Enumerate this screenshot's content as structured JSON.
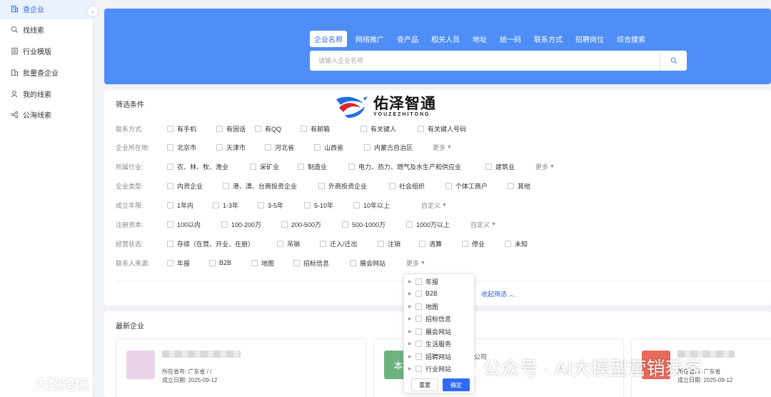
{
  "sidebar": {
    "items": [
      {
        "label": "查企业",
        "icon": "building-icon",
        "active": true
      },
      {
        "label": "找线索",
        "icon": "search-icon"
      },
      {
        "label": "行业模版",
        "icon": "document-icon"
      },
      {
        "label": "批量查企业",
        "icon": "buildings-icon"
      },
      {
        "label": "我的线索",
        "icon": "user-icon"
      },
      {
        "label": "公海线索",
        "icon": "share-icon"
      }
    ],
    "collapse_glyph": "‹"
  },
  "search": {
    "tabs": [
      "企业名称",
      "网络推广",
      "查产品",
      "相关人员",
      "地址",
      "统一码",
      "联系方式",
      "招聘岗位",
      "综合搜索"
    ],
    "placeholder": "请输入企业名称",
    "value": ""
  },
  "logo": {
    "cn": "佑泽智通",
    "en": "YOUZEZHITONG"
  },
  "filter": {
    "title": "筛选条件",
    "rows": [
      {
        "label": "联系方式:",
        "options": [
          "有手机",
          "有固话",
          "有QQ",
          "有邮箱",
          "有关键人",
          "有关键人号码"
        ]
      },
      {
        "label": "企业所在地:",
        "options": [
          "北京市",
          "天津市",
          "河北省",
          "山西省",
          "内蒙古自治区"
        ],
        "more": "更多"
      },
      {
        "label": "所属行业:",
        "options": [
          "农、林、牧、渔业",
          "采矿业",
          "制造业",
          "电力、热力、燃气及水生产和供应业",
          "建筑业"
        ],
        "more": "更多"
      },
      {
        "label": "企业类型:",
        "options": [
          "内资企业",
          "港、澳、台商投资企业",
          "外商投资企业",
          "社会组织",
          "个体工商户",
          "其他"
        ]
      },
      {
        "label": "成立年限:",
        "options": [
          "1年内",
          "1-3年",
          "3-5年",
          "5-10年",
          "10年以上"
        ],
        "more": "自定义"
      },
      {
        "label": "注册资本:",
        "options": [
          "100以内",
          "100-200万",
          "200-500万",
          "500-1000万",
          "1000万以上"
        ],
        "more": "自定义"
      },
      {
        "label": "经营状态:",
        "options": [
          "存续（在营、开业、在册）",
          "吊销",
          "迁入/迁出",
          "注销",
          "清算",
          "停业",
          "未知"
        ]
      },
      {
        "label": "联系人来源:",
        "options": [
          "年报",
          "B2B",
          "地图",
          "招标信息",
          "展会网站"
        ],
        "more": "更多"
      }
    ],
    "collapse_label": "收起筛选"
  },
  "dropdown": {
    "items": [
      "年报",
      "B2B",
      "地图",
      "招标信息",
      "展会网站",
      "生活服务",
      "招聘网站",
      "行业网站"
    ],
    "reset_label": "重置",
    "confirm_label": "确定"
  },
  "latest": {
    "title": "最新企业",
    "cards": [
      {
        "location": "所在省市: 广东省 / /",
        "founded": "成立日期: 2025-09-12",
        "avatar_color": "#e9d3ea"
      },
      {
        "avatar_text": "本",
        "name_suffix": "公司",
        "avatar_color": "#6db37f"
      },
      {
        "location": "所在省市: 广东省",
        "founded": "成立日期: 2025-09-12",
        "avatar_color": "#e86a5c"
      }
    ]
  },
  "watermarks": {
    "left": "大数跨境",
    "right": "公众号 · AI大模型营销获客"
  },
  "colors": {
    "accent": "#2f6bf5",
    "hero": "#4f8ef7",
    "sidebar_active_bg": "#eaf1ff"
  }
}
